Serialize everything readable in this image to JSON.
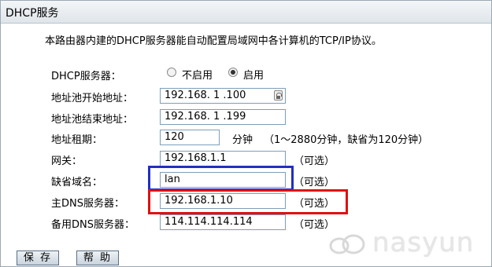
{
  "header": {
    "title": "DHCP服务"
  },
  "description": "本路由器内建的DHCP服务器能自动配置局域网中各计算机的TCP/IP协议。",
  "dhcp_server": {
    "label": "DHCP服务器：",
    "options": [
      {
        "label": "不启用",
        "checked": false
      },
      {
        "label": "启用",
        "checked": true
      }
    ]
  },
  "pool_start": {
    "label": "地址池开始地址：",
    "value": "192.168. 1 .100"
  },
  "pool_end": {
    "label": "地址池结束地址：",
    "value": "192.168. 1 .199"
  },
  "lease": {
    "label": "地址租期：",
    "value": "120",
    "unit": "分钟",
    "hint": "（1～2880分钟，缺省为120分钟）"
  },
  "gateway": {
    "label": "网关：",
    "value": "192.168.1.1",
    "hint": "（可选）"
  },
  "domain": {
    "label": "缺省域名：",
    "value": "lan",
    "hint": "（可选）"
  },
  "primary_dns": {
    "label": "主DNS服务器：",
    "value": "192.168.1.10",
    "hint": "（可选）"
  },
  "secondary_dns": {
    "label": "备用DNS服务器：",
    "value": "114.114.114.114",
    "hint": "（可选）"
  },
  "buttons": {
    "save": "保 存",
    "help": "帮 助"
  },
  "watermark": {
    "text": "nasyun",
    "icon": "cloud-logo-icon"
  },
  "colors": {
    "highlight_blue": "#2030c0",
    "highlight_red": "#e01010"
  }
}
